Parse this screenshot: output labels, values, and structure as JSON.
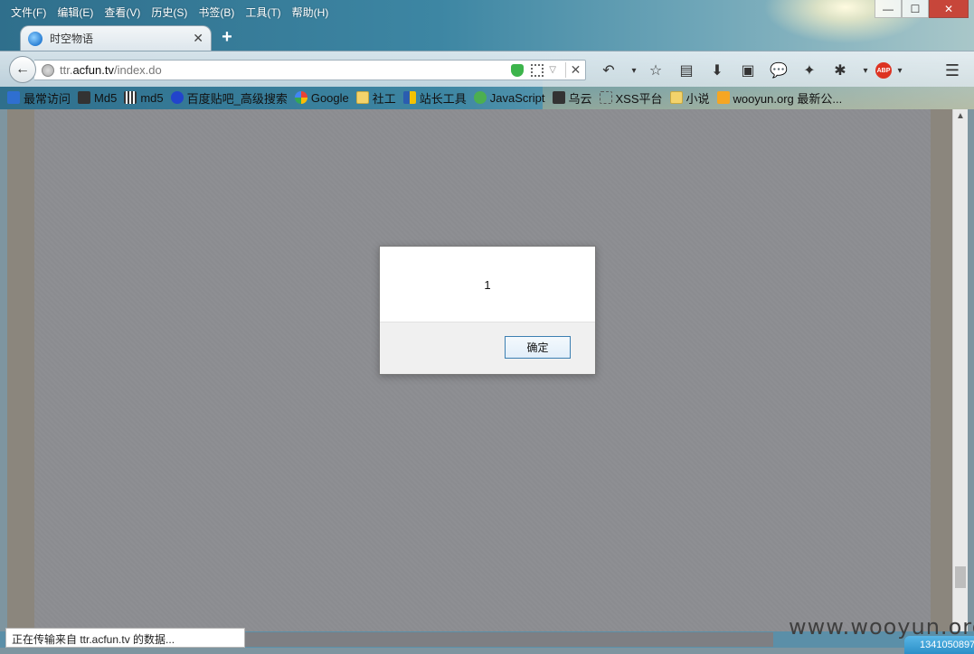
{
  "menubar": {
    "items": [
      "文件(F)",
      "编辑(E)",
      "查看(V)",
      "历史(S)",
      "书签(B)",
      "工具(T)",
      "帮助(H)"
    ]
  },
  "window_controls": {
    "minimize": "—",
    "maximize": "☐",
    "close": "✕"
  },
  "tab": {
    "title": "时空物语",
    "close": "✕",
    "new_tab": "+"
  },
  "navbar": {
    "back": "←",
    "url_prefix": "ttr.",
    "url_host": "acfun.tv",
    "url_path": "/index.do",
    "stop": "✕"
  },
  "toolbar_icons": [
    "undo-icon",
    "star-icon",
    "reading-list-icon",
    "download-icon",
    "screenshot-icon",
    "chat-icon",
    "bird-icon",
    "bug-icon",
    "abp-icon",
    "menu-icon"
  ],
  "abp_label": "ABP",
  "bookmarks": [
    {
      "label": "最常访问",
      "icon": "blue"
    },
    {
      "label": "Md5",
      "icon": "dark"
    },
    {
      "label": "md5",
      "icon": "grid"
    },
    {
      "label": "百度贴吧_高级搜索",
      "icon": "paw"
    },
    {
      "label": "Google",
      "icon": "google"
    },
    {
      "label": "社工",
      "icon": "folder"
    },
    {
      "label": "站长工具",
      "icon": "zhan"
    },
    {
      "label": "JavaScript",
      "icon": "green"
    },
    {
      "label": "乌云",
      "icon": "dark"
    },
    {
      "label": "XSS平台",
      "icon": "dotted"
    },
    {
      "label": "小说",
      "icon": "folder"
    },
    {
      "label": "wooyun.org 最新公...",
      "icon": "rss"
    }
  ],
  "dialog": {
    "message": "1",
    "ok_label": "确定"
  },
  "status": {
    "text": "正在传输来自 ttr.acfun.tv 的数据..."
  },
  "watermark": "www.wooyun.org",
  "taskbar": {
    "text": "1341050897"
  }
}
